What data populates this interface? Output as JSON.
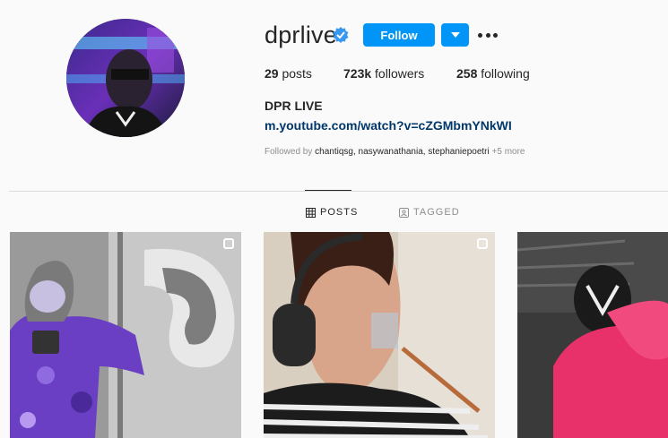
{
  "profile": {
    "username": "dprlive",
    "verified_icon": "verified-badge-icon",
    "follow_label": "Follow",
    "posts_count": "29",
    "posts_label": "posts",
    "followers_count": "723k",
    "followers_label": "followers",
    "following_count": "258",
    "following_label": "following",
    "full_name": "DPR LIVE",
    "link": "m.youtube.com/watch?v=cZGMbmYNkWI",
    "followed_by_prefix": "Followed by",
    "followed_by_names": "chantiqsg, nasywanathania, stephaniepoetri",
    "followed_by_more": "+5 more"
  },
  "tabs": {
    "posts": "POSTS",
    "tagged": "TAGGED"
  },
  "colors": {
    "accent": "#0095f6",
    "link": "#00376b",
    "muted": "#8e8e8e"
  }
}
